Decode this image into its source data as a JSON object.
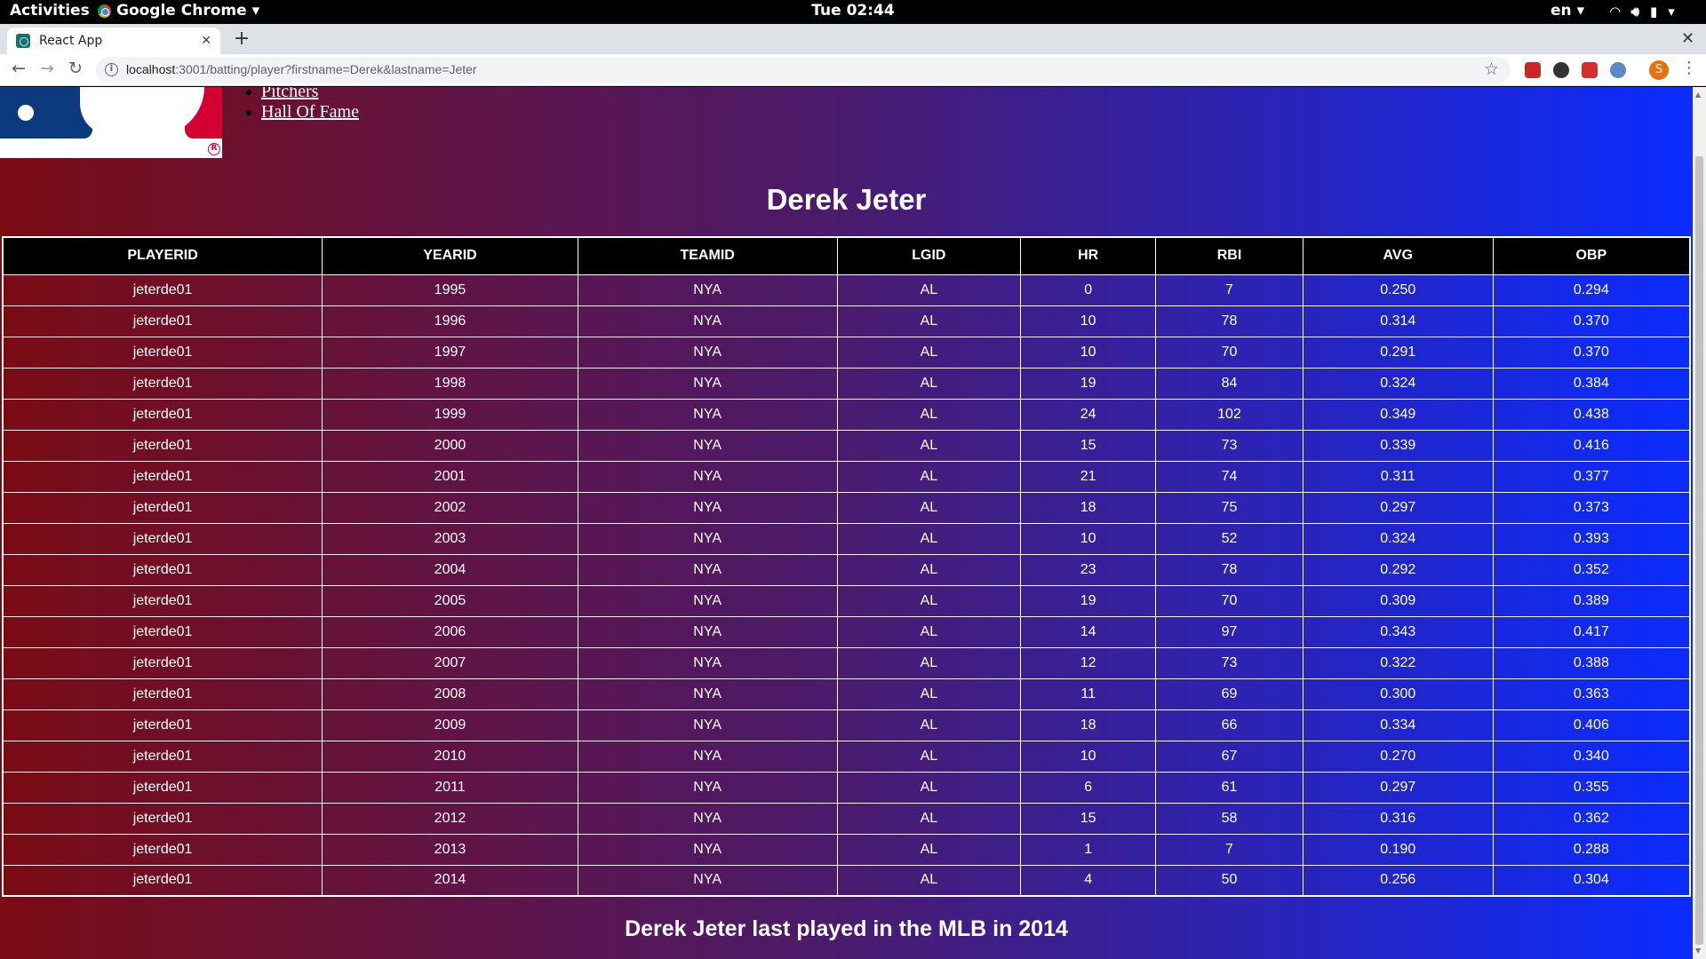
{
  "topbar": {
    "activities": "Activities",
    "app_name": "Google Chrome",
    "clock": "Tue 02:44",
    "lang": "en"
  },
  "browser": {
    "tab_title": "React App",
    "url_host": "localhost",
    "url_rest": ":3001/batting/player?firstname=Derek&lastname=Jeter",
    "profile_initial": "S"
  },
  "nav": {
    "items": [
      "Pitchers",
      "Hall Of Fame"
    ]
  },
  "player": {
    "name": "Derek Jeter"
  },
  "table": {
    "headers": [
      "PLAYERID",
      "YEARID",
      "TEAMID",
      "LGID",
      "HR",
      "RBI",
      "AVG",
      "OBP"
    ],
    "rows": [
      [
        "jeterde01",
        "1995",
        "NYA",
        "AL",
        "0",
        "7",
        "0.250",
        "0.294"
      ],
      [
        "jeterde01",
        "1996",
        "NYA",
        "AL",
        "10",
        "78",
        "0.314",
        "0.370"
      ],
      [
        "jeterde01",
        "1997",
        "NYA",
        "AL",
        "10",
        "70",
        "0.291",
        "0.370"
      ],
      [
        "jeterde01",
        "1998",
        "NYA",
        "AL",
        "19",
        "84",
        "0.324",
        "0.384"
      ],
      [
        "jeterde01",
        "1999",
        "NYA",
        "AL",
        "24",
        "102",
        "0.349",
        "0.438"
      ],
      [
        "jeterde01",
        "2000",
        "NYA",
        "AL",
        "15",
        "73",
        "0.339",
        "0.416"
      ],
      [
        "jeterde01",
        "2001",
        "NYA",
        "AL",
        "21",
        "74",
        "0.311",
        "0.377"
      ],
      [
        "jeterde01",
        "2002",
        "NYA",
        "AL",
        "18",
        "75",
        "0.297",
        "0.373"
      ],
      [
        "jeterde01",
        "2003",
        "NYA",
        "AL",
        "10",
        "52",
        "0.324",
        "0.393"
      ],
      [
        "jeterde01",
        "2004",
        "NYA",
        "AL",
        "23",
        "78",
        "0.292",
        "0.352"
      ],
      [
        "jeterde01",
        "2005",
        "NYA",
        "AL",
        "19",
        "70",
        "0.309",
        "0.389"
      ],
      [
        "jeterde01",
        "2006",
        "NYA",
        "AL",
        "14",
        "97",
        "0.343",
        "0.417"
      ],
      [
        "jeterde01",
        "2007",
        "NYA",
        "AL",
        "12",
        "73",
        "0.322",
        "0.388"
      ],
      [
        "jeterde01",
        "2008",
        "NYA",
        "AL",
        "11",
        "69",
        "0.300",
        "0.363"
      ],
      [
        "jeterde01",
        "2009",
        "NYA",
        "AL",
        "18",
        "66",
        "0.334",
        "0.406"
      ],
      [
        "jeterde01",
        "2010",
        "NYA",
        "AL",
        "10",
        "67",
        "0.270",
        "0.340"
      ],
      [
        "jeterde01",
        "2011",
        "NYA",
        "AL",
        "6",
        "61",
        "0.297",
        "0.355"
      ],
      [
        "jeterde01",
        "2012",
        "NYA",
        "AL",
        "15",
        "58",
        "0.316",
        "0.362"
      ],
      [
        "jeterde01",
        "2013",
        "NYA",
        "AL",
        "1",
        "7",
        "0.190",
        "0.288"
      ],
      [
        "jeterde01",
        "2014",
        "NYA",
        "AL",
        "4",
        "50",
        "0.256",
        "0.304"
      ]
    ]
  },
  "footer": {
    "last_played": "Derek Jeter last played in the MLB in 2014"
  }
}
